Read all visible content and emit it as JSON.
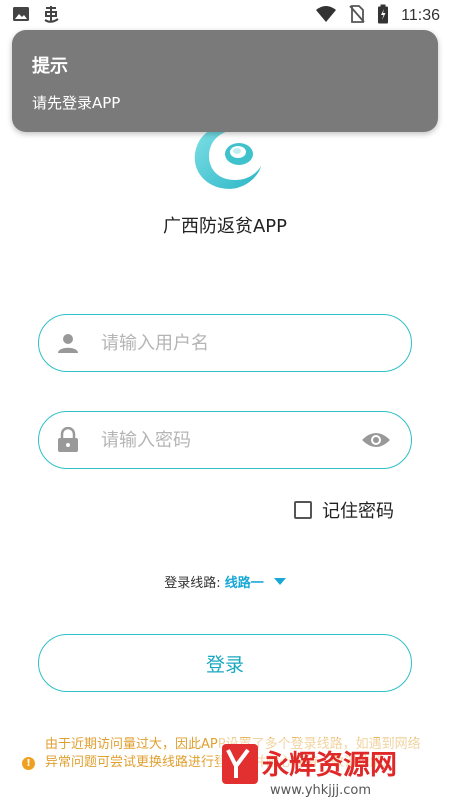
{
  "status_bar": {
    "time": "11:36",
    "left_icons": [
      "image-icon",
      "debug-icon"
    ],
    "right_icons": [
      "wifi-icon",
      "no-sim-icon",
      "battery-icon"
    ]
  },
  "toast": {
    "title": "提示",
    "message": "请先登录APP"
  },
  "app": {
    "title": "广西防返贫APP"
  },
  "form": {
    "username_placeholder": "请输入用户名",
    "password_placeholder": "请输入密码",
    "remember_label": "记住密码",
    "remember_checked": false,
    "route_label": "登录线路:",
    "route_value": "线路一",
    "login_label": "登录"
  },
  "notice": {
    "text": "由于近期访问量过大，因此APP设置了多个登录线路，如遇到网络异常问题可尝试更换线路进行登录，并耐心等待，敬请谅解。"
  },
  "watermark": {
    "text": "永辉资源网",
    "url": "www.yhkjjj.com"
  },
  "colors": {
    "accent": "#2fc0c8",
    "route": "#19a8d6",
    "notice": "#e0a030",
    "toast_bg": "#7a7a7a"
  }
}
